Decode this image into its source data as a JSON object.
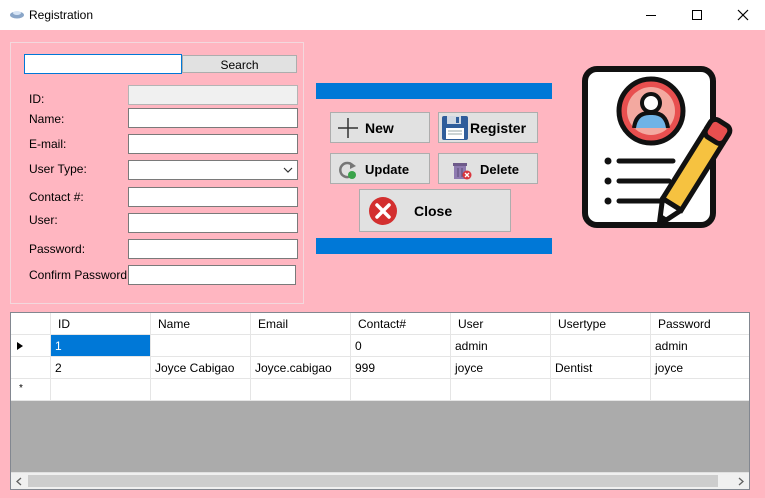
{
  "window": {
    "title": "Registration",
    "app_icon": "app-icon"
  },
  "form": {
    "search_value": "",
    "search_button": "Search",
    "fields": [
      {
        "label": "ID:",
        "value": ""
      },
      {
        "label": "Name:",
        "value": ""
      },
      {
        "label": "E-mail:",
        "value": ""
      },
      {
        "label": "User Type:",
        "value": ""
      },
      {
        "label": "Contact #:",
        "value": ""
      },
      {
        "label": "User:",
        "value": ""
      },
      {
        "label": "Password:",
        "value": ""
      },
      {
        "label": "Confirm Password:",
        "value": ""
      }
    ]
  },
  "actions": {
    "new": "New",
    "register": "Register",
    "update": "Update",
    "delete": "Delete",
    "close": "Close"
  },
  "grid": {
    "columns": [
      "ID",
      "Name",
      "Email",
      "Contact#",
      "User",
      "Usertype",
      "Password"
    ],
    "rows": [
      [
        "1",
        "",
        "",
        "0",
        "admin",
        "",
        "admin"
      ],
      [
        "2",
        "Joyce Cabigao",
        "Joyce.cabigao",
        "999",
        "joyce",
        "Dentist",
        "joyce"
      ]
    ],
    "new_row_marker": "*"
  },
  "colors": {
    "background": "#ffb6c1",
    "accent": "#0078d7"
  }
}
